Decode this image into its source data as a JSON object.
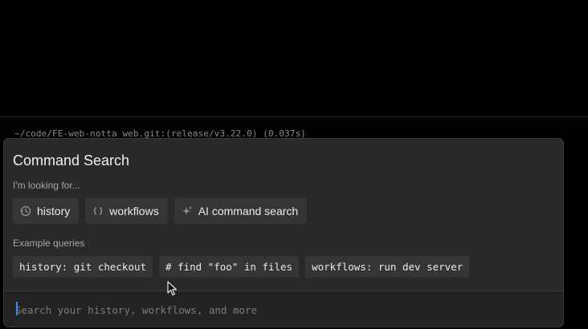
{
  "terminal": {
    "previous_prompt": "~/code/FE-web-notta_web.git:(release/v3.22.0) (0.037s)"
  },
  "command_search": {
    "title": "Command Search",
    "looking_for_label": "I'm looking for...",
    "filters": [
      {
        "label": "history",
        "icon": "history-clock-icon"
      },
      {
        "label": "workflows",
        "icon": "workflow-braces-icon"
      },
      {
        "label": "AI command search",
        "icon": "ai-sparkle-icon"
      }
    ],
    "examples_label": "Example queries",
    "examples": [
      {
        "text": "history: git checkout"
      },
      {
        "text": "# find \"foo\" in files"
      },
      {
        "text": "workflows: run dev server"
      }
    ],
    "search": {
      "placeholder": "Search your history, workflows, and more",
      "value": ""
    }
  },
  "colors": {
    "panel_bg": "#292929",
    "chip_bg": "#353535",
    "caret": "#3b8eea",
    "terminal_bg": "#000000"
  }
}
